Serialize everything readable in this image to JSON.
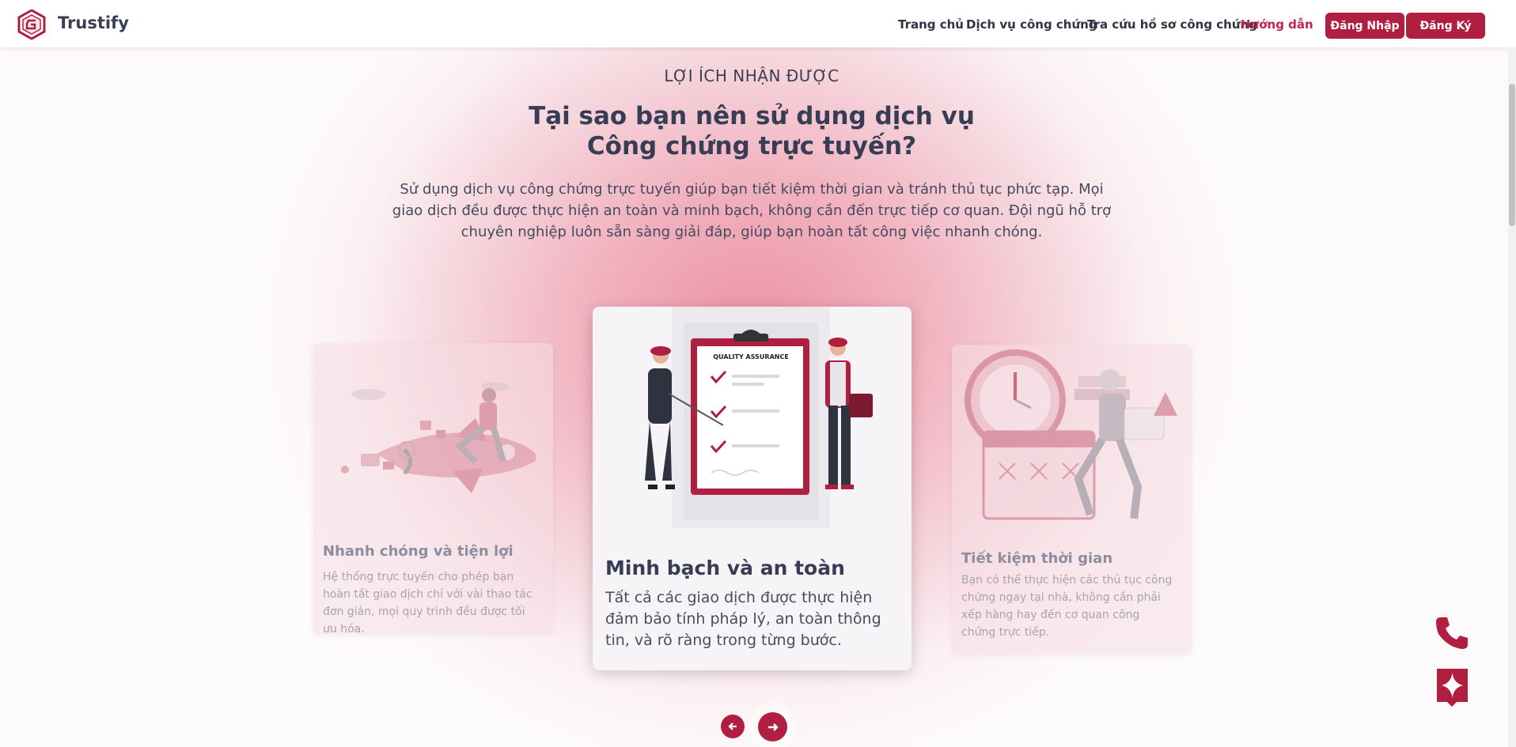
{
  "header": {
    "brand": "Trustify",
    "nav": [
      "Trang chủ",
      "Dịch vụ công chứng",
      "Tra cứu hồ sơ công chứng",
      "Hướng dẫn"
    ],
    "login_label": "Đăng Nhập",
    "register_label": "Đăng Ký"
  },
  "section": {
    "kicker": "LỢI ÍCH NHẬN ĐƯỢC",
    "title_line1": "Tại sao bạn nên sử dụng dịch vụ",
    "title_line2": "Công chứng trực tuyến?",
    "description": "Sử dụng dịch vụ công chứng trực tuyến giúp bạn tiết kiệm thời gian và tránh thủ tục phức tạp. Mọi giao dịch đều được thực hiện an toàn và minh bạch, không cần đến trực tiếp cơ quan. Đội ngũ hỗ trợ chuyên nghiệp luôn sẵn sàng giải đáp, giúp bạn hoàn tất công việc nhanh chóng."
  },
  "cards": [
    {
      "title": "Nhanh chóng và tiện lợi",
      "text": "Hệ thống trực tuyến cho phép bạn hoàn tất giao dịch chỉ với vài thao tác đơn giản, mọi quy trình đều được tối ưu hóa."
    },
    {
      "title": "Minh bạch và an toàn",
      "text": "Tất cả các giao dịch được thực hiện đảm bảo tính pháp lý, an toàn thông tin, và rõ ràng trong từng bước.",
      "clipboard_label": "QUALITY ASSURANCE"
    },
    {
      "title": "Tiết kiệm thời gian",
      "text": "Bạn có thể thực hiện các thủ tục công chứng ngay tại nhà, không cần phải xếp hàng hay đến cơ quan công chứng trực tiếp."
    }
  ],
  "colors": {
    "accent": "#b01e40",
    "active_nav": "#c0264c",
    "text_dark": "#373d55"
  },
  "icons": {
    "prev": "arrow-left-icon",
    "next": "arrow-right-icon",
    "phone": "phone-icon",
    "ai": "sparkle-chat-icon"
  }
}
